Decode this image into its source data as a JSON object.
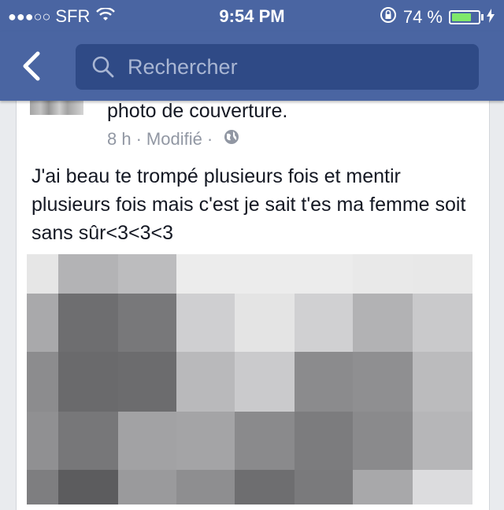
{
  "status_bar": {
    "signal": "●●●○○",
    "carrier": "SFR",
    "time": "9:54 PM",
    "battery_percent": "74 %",
    "battery_level": 0.74
  },
  "navbar": {
    "search_placeholder": "Rechercher"
  },
  "post": {
    "title_fragment": "photo de couverture.",
    "time": "8 h",
    "edited": "Modifié",
    "separator": "·",
    "text": "J'ai beau te trompé plusieurs fois et mentir plusieurs fois mais c'est je sait t'es ma femme soit sans sûr<3<3<3",
    "image": "pixelated-photo"
  },
  "colors": {
    "navbar": "#4a65a2",
    "search_field": "#2f4a86",
    "battery_fill": "#7fe86a",
    "text": "#141823",
    "meta": "#9197a3"
  }
}
